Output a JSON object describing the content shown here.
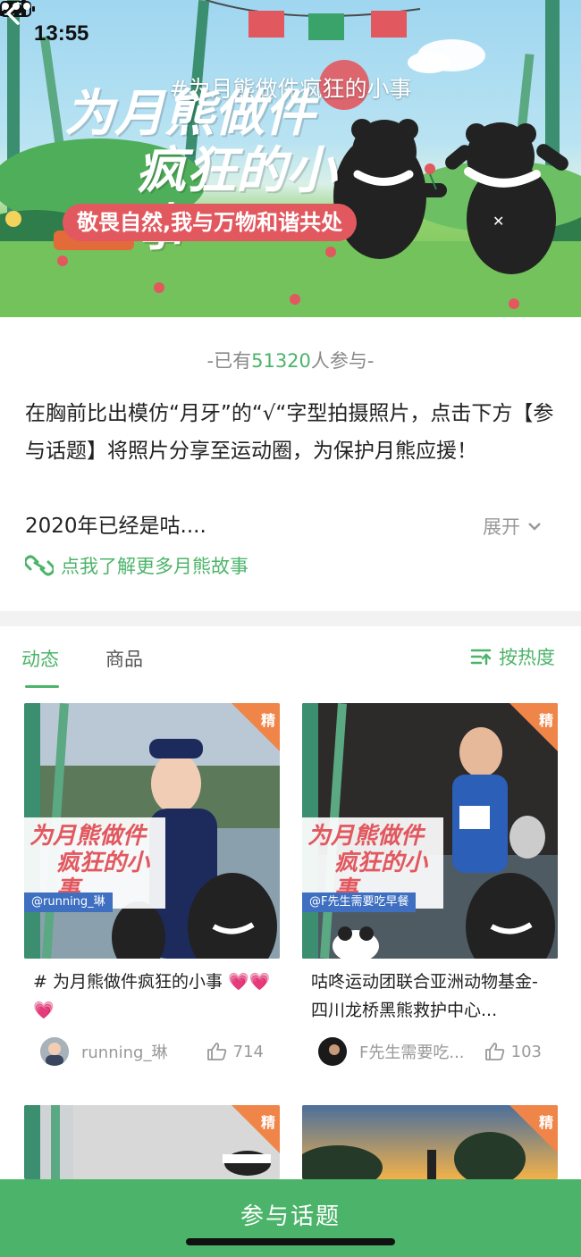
{
  "status_bar": {
    "time": "13:55"
  },
  "nav": {
    "title": "#为月熊做件疯狂的小事"
  },
  "banner": {
    "title_line1": "为月熊做件",
    "title_line2": "疯狂的小事",
    "slogan": "敬畏自然,我与万物和谐共处"
  },
  "info": {
    "participants_prefix": "-已有",
    "participants_count": "51320",
    "participants_suffix": "人参与-",
    "description": "在胸前比出模仿“月牙”的“√“字型拍摄照片，点击下方【参与话题】将照片分享至运动圈，为保护月熊应援！",
    "description_last": "2020年已经是咕....",
    "expand_label": "展开",
    "story_link": "点我了解更多月熊故事"
  },
  "tabs": [
    {
      "label": "动态",
      "active": true
    },
    {
      "label": "商品",
      "active": false
    }
  ],
  "sort_label": "按热度",
  "cards": [
    {
      "badge": "精",
      "overlay_title_l1": "为月熊做件",
      "overlay_title_l2": "疯狂的小事",
      "user_tag": "@running_琳",
      "text": "# 为月熊做件疯狂的小事 💗💗💗",
      "username": "running_琳",
      "likes": "714"
    },
    {
      "badge": "精",
      "overlay_title_l1": "为月熊做件",
      "overlay_title_l2": "疯狂的小事",
      "user_tag": "@F先生需要吃早餐",
      "text": "咕咚运动团联合亚洲动物基金-四川龙桥黑熊救护中心...",
      "username": "F先生需要吃...",
      "likes": "103"
    },
    {
      "badge": "精"
    },
    {
      "badge": "精"
    }
  ],
  "join_button": "参与话题",
  "colors": {
    "accent": "#4cb46a",
    "badge": "#f0854a",
    "slogan": "#e2585f"
  }
}
